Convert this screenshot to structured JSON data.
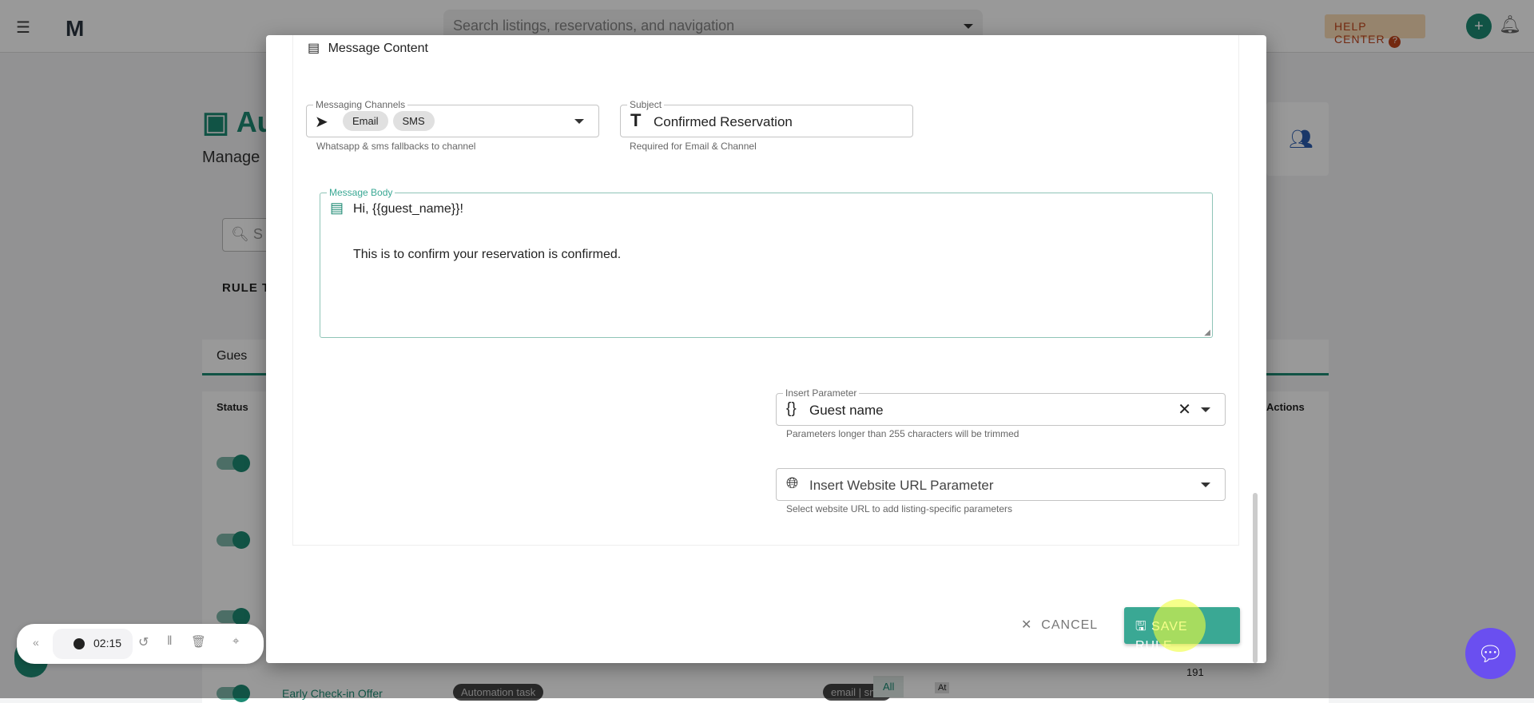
{
  "topbar": {
    "search_placeholder": "Search listings, reservations, and navigation",
    "help_center": "HELP CENTER",
    "help_icon": "?",
    "add_icon": "+"
  },
  "background": {
    "title": "Au",
    "subtitle": "Manage",
    "search_placeholder": "S",
    "rule_types_label": "RULE T",
    "tab_label": "Gues",
    "col_status": "Status",
    "col_actions": "Actions",
    "row_name": "Early Check-in Offer",
    "row_type": "Automation task",
    "row_channel": "email | sms",
    "row_listing": "All",
    "row_at": "At",
    "row_count": "191"
  },
  "modal": {
    "section_title": "Message Content",
    "channels": {
      "label": "Messaging Channels",
      "chips": [
        "Email",
        "SMS"
      ],
      "helper": "Whatsapp & sms fallbacks to channel"
    },
    "subject": {
      "label": "Subject",
      "value": "Confirmed Reservation",
      "helper": "Required for Email & Channel"
    },
    "body": {
      "label": "Message Body",
      "line1": "Hi, {{guest_name}}!",
      "line2": "This is to confirm your reservation is confirmed."
    },
    "param": {
      "label": "Insert Parameter",
      "value": "Guest name",
      "helper": "Parameters longer than 255 characters will be trimmed"
    },
    "url": {
      "placeholder": "Insert Website URL Parameter",
      "helper": "Select website URL to add listing-specific parameters"
    },
    "cancel": "CANCEL",
    "save": "SAVE RULE"
  },
  "recorder": {
    "time": "02:15"
  },
  "colors": {
    "accent": "#1d8a73",
    "save": "#3aa894",
    "chat": "#6a4ff0"
  }
}
